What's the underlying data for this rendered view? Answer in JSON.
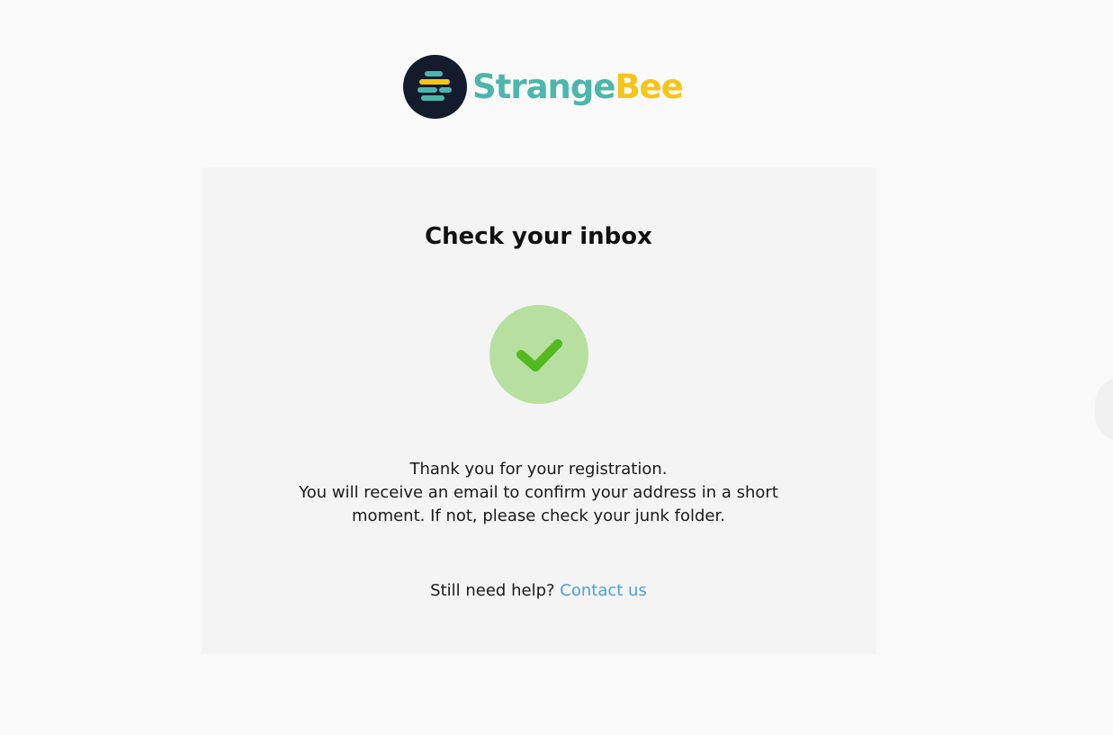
{
  "brand": {
    "name_part1": "Strange",
    "name_part2": "Bee",
    "colors": {
      "primary_teal": "#4db6ac",
      "accent_yellow": "#f5c518",
      "dark": "#141b2d"
    }
  },
  "card": {
    "title": "Check your inbox",
    "status_icon": "check-icon",
    "status_color": "#b7dfa0",
    "message_line1": "Thank you for your registration.",
    "message_line2": "You will receive an email to confirm your address in a short moment. If not, please check your junk folder.",
    "help_prefix": "Still need help?",
    "help_link": "Contact us",
    "link_color": "#4a9fe0"
  }
}
